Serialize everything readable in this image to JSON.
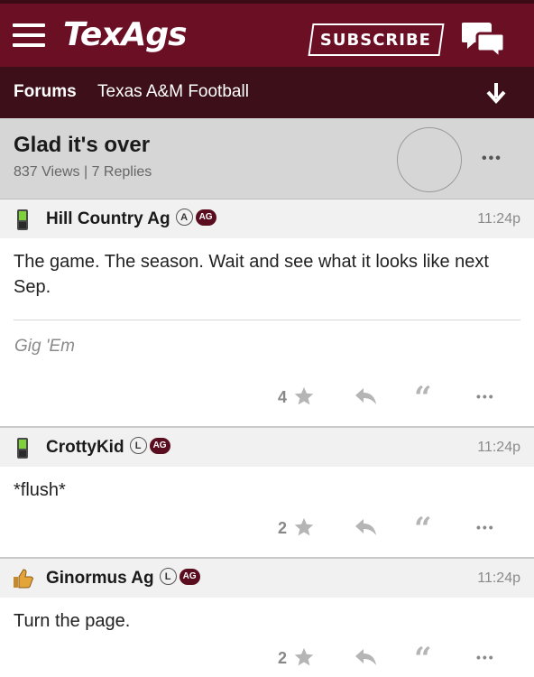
{
  "header": {
    "logo": "TexAgs",
    "subscribe_label": "SUBSCRIBE"
  },
  "breadcrumb": {
    "forums": "Forums",
    "board": "Texas A&M Football"
  },
  "thread": {
    "title": "Glad it's over",
    "stats": "837 Views | 7 Replies",
    "more": "•••"
  },
  "posts": [
    {
      "user": "Hill Country Ag",
      "badge": "A",
      "ag": "AG",
      "time": "11:24p",
      "body": "The game. The season. Wait and see what it looks like next Sep.",
      "signature": "Gig 'Em",
      "stars": "4",
      "more": "•••",
      "quote": "“",
      "icon": "phone-icon"
    },
    {
      "user": "CrottyKid",
      "badge": "L",
      "ag": "AG",
      "time": "11:24p",
      "body": "*flush*",
      "stars": "2",
      "more": "•••",
      "quote": "“",
      "icon": "phone-icon"
    },
    {
      "user": "Ginormus Ag",
      "badge": "L",
      "ag": "AG",
      "time": "11:24p",
      "body": "Turn the page.",
      "stars": "2",
      "more": "•••",
      "quote": "“",
      "icon": "thumbs-up-icon"
    }
  ],
  "colors": {
    "brand": "#6b0f24",
    "brand_dark": "#3d1019",
    "ag_badge": "#5a0d1e"
  }
}
